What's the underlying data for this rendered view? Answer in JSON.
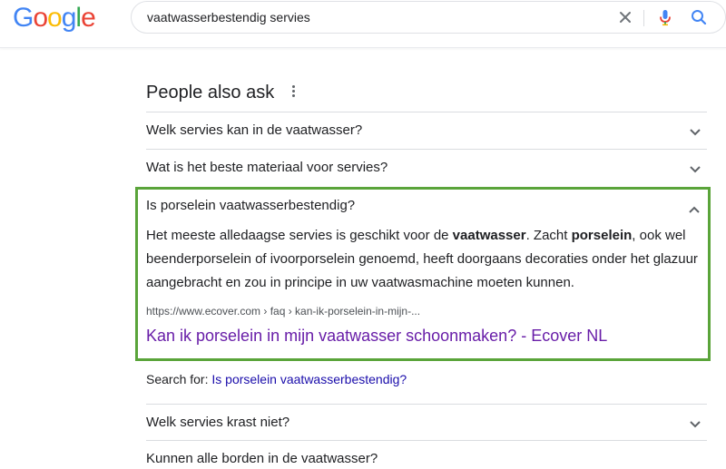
{
  "header": {
    "logo_letters": [
      {
        "ch": "G",
        "color": "#4285F4"
      },
      {
        "ch": "o",
        "color": "#EA4335"
      },
      {
        "ch": "o",
        "color": "#FBBC05"
      },
      {
        "ch": "g",
        "color": "#4285F4"
      },
      {
        "ch": "l",
        "color": "#34A853"
      },
      {
        "ch": "e",
        "color": "#EA4335"
      }
    ],
    "search_query": "vaatwasserbestendig servies",
    "icons": [
      "close-icon",
      "mic-icon",
      "search-icon"
    ]
  },
  "paa": {
    "title": "People also ask",
    "questions": [
      "Welk servies kan in de vaatwasser?",
      "Wat is het beste materiaal voor servies?"
    ],
    "expanded": {
      "question": "Is porselein vaatwasserbestendig?",
      "answer": [
        {
          "t": "Het meeste alledaagse servies is geschikt voor de ",
          "b": false
        },
        {
          "t": "vaatwasser",
          "b": true
        },
        {
          "t": ". Zacht ",
          "b": false
        },
        {
          "t": "porselein",
          "b": true
        },
        {
          "t": ", ook wel beenderporselein of ivoorporselein genoemd, heeft doorgaans decoraties onder het glazuur aangebracht en zou in principe in uw vaatwasmachine moeten kunnen.",
          "b": false
        }
      ],
      "source_url": "https://www.ecover.com › faq › kan-ik-porselein-in-mijn-...",
      "source_title": "Kan ik porselein in mijn vaatwasser schoonmaken? - Ecover NL",
      "search_for_label": "Search for: ",
      "search_for_link": "Is porselein vaatwasserbestendig?"
    },
    "more_questions": [
      "Welk servies krast niet?",
      "Kunnen alle borden in de vaatwasser?"
    ]
  },
  "colors": {
    "highlight_border": "#5aa43a",
    "visited_link": "#681da8",
    "link": "#1a0dab"
  }
}
